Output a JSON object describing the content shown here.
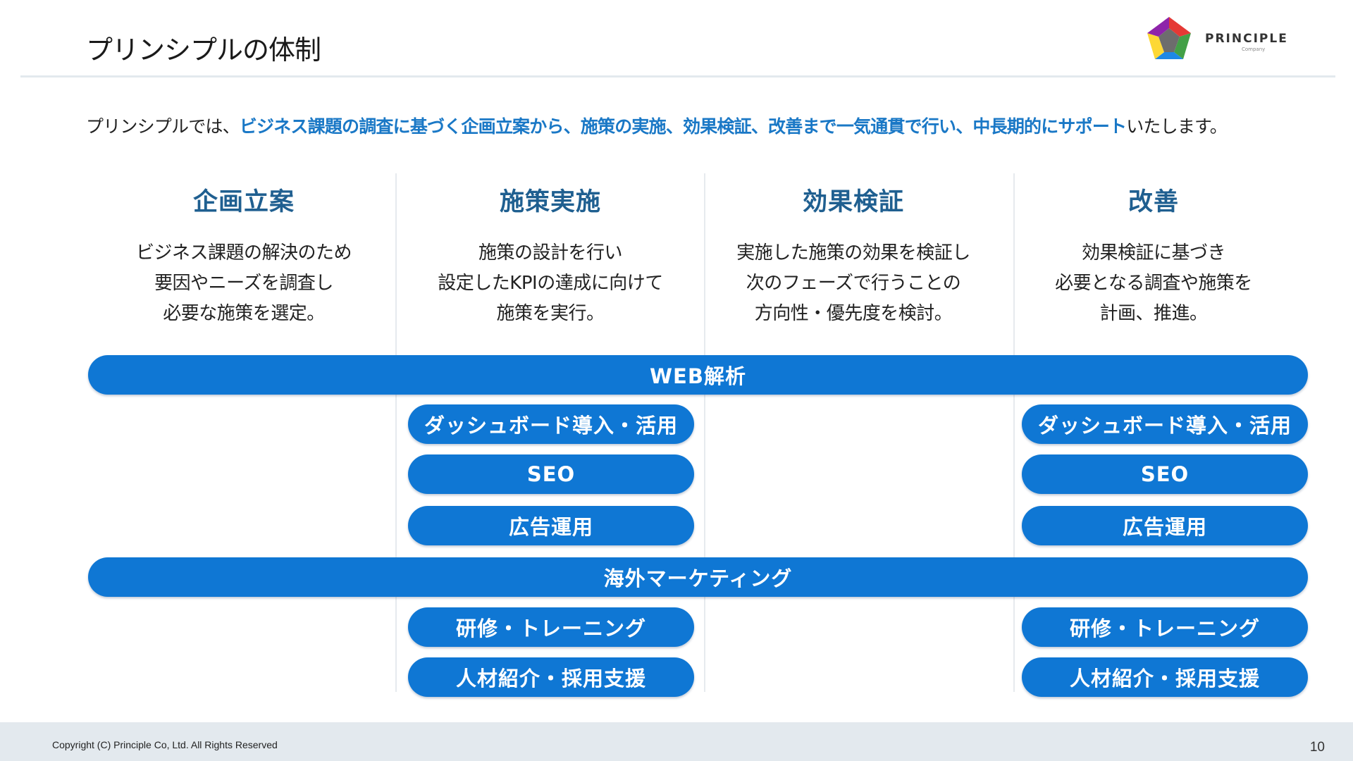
{
  "header": {
    "title": "プリンシプルの体制",
    "logo": {
      "name": "PRINCIPLE",
      "sub": "Company",
      "icon": "pentagon-logo-icon"
    }
  },
  "intro": {
    "prefix": "プリンシプルでは、",
    "highlight": "ビジネス課題の調査に基づく企画立案から、施策の実施、効果検証、改善まで一気通貫で行い、中長期的にサポート",
    "suffix": "いたします。"
  },
  "columns": [
    {
      "heading": "企画立案",
      "lines": [
        "ビジネス課題の解決のため",
        "要因やニーズを調査し",
        "必要な施策を選定。"
      ]
    },
    {
      "heading": "施策実施",
      "lines": [
        "施策の設計を行い",
        "設定したKPIの達成に向けて",
        "施策を実行。"
      ]
    },
    {
      "heading": "効果検証",
      "lines": [
        "実施した施策の効果を検証し",
        "次のフェーズで行うことの",
        "方向性・優先度を検討。"
      ]
    },
    {
      "heading": "改善",
      "lines": [
        "効果検証に基づき",
        "必要となる調査や施策を",
        "計画、推進。"
      ]
    }
  ],
  "services": {
    "web": "WEB解析",
    "web_items": [
      "ダッシュボード導入・活用",
      "SEO",
      "広告運用"
    ],
    "global": "海外マーケティング",
    "global_items": [
      "研修・トレーニング",
      "人材紹介・採用支援"
    ]
  },
  "footer": {
    "copyright": "Copyright (C) Principle Co, Ltd. All Rights Reserved",
    "page": "10"
  },
  "colors": {
    "accent": "#0f77d4",
    "heading": "#1f5f90",
    "highlight": "#1a78c6"
  }
}
